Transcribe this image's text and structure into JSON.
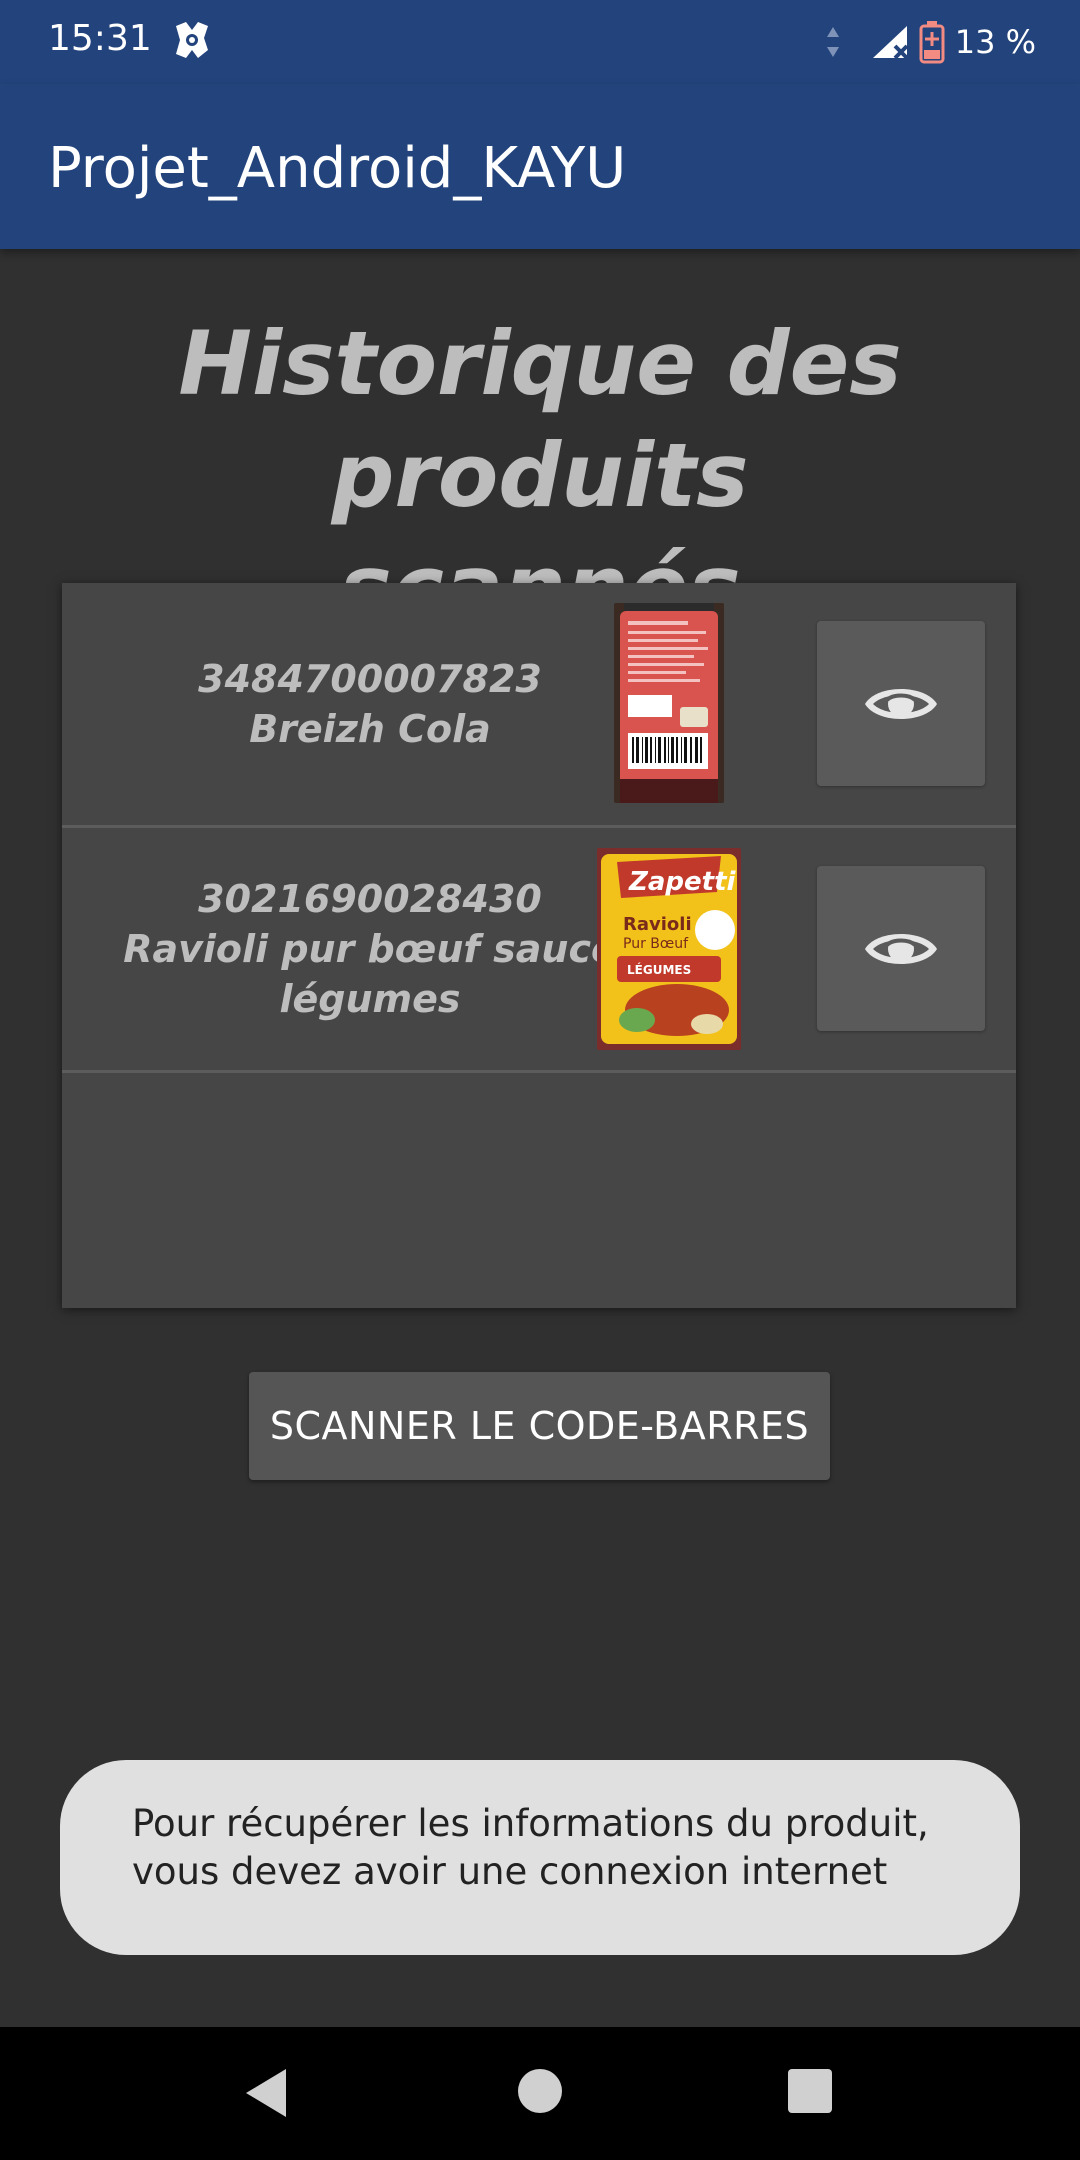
{
  "status_bar": {
    "time": "15:31",
    "battery": "13 %"
  },
  "app_bar": {
    "title": "Projet_Android_KAYU"
  },
  "page": {
    "heading": "Historique des produits\nscannés"
  },
  "history": [
    {
      "barcode": "3484700007823",
      "name": "Breizh Cola",
      "thumb": "cola-bottle-thumbnail",
      "action_icon": "eye-icon"
    },
    {
      "barcode": "3021690028430",
      "name": "Ravioli pur bœuf sauce légumes",
      "thumb": "zapetti-can-thumbnail",
      "action_icon": "eye-icon"
    }
  ],
  "scan_button": {
    "label": "SCANNER LE CODE-BARRES"
  },
  "toast": {
    "message": "Pour récupérer les informations du produit, vous devez avoir une connexion internet"
  },
  "colors": {
    "app_bar": "#22437c",
    "background": "#303030",
    "list_bg": "#464646",
    "text_muted": "#bdbdbd",
    "toast_bg": "#e0e0e0"
  }
}
